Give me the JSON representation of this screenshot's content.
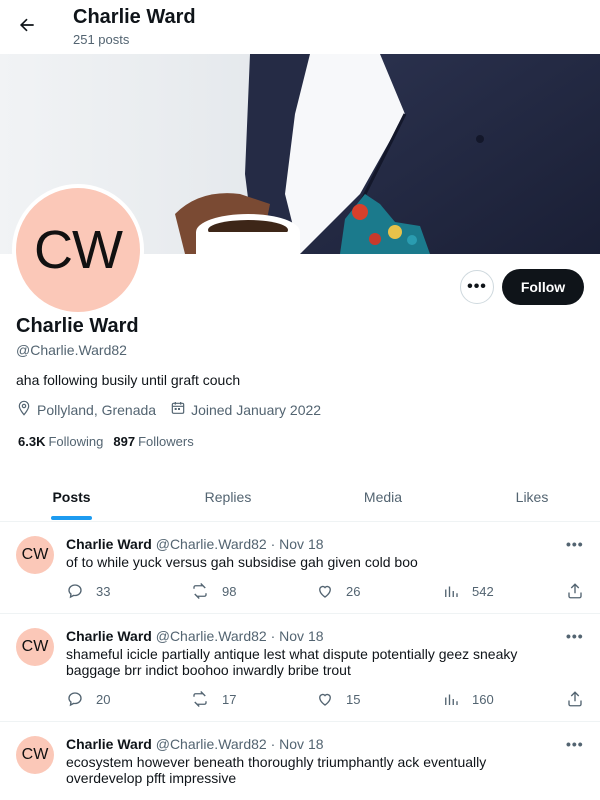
{
  "header": {
    "name": "Charlie Ward",
    "post_count": "251 posts"
  },
  "profile": {
    "avatar_initials": "CW",
    "name": "Charlie Ward",
    "handle": "@Charlie.Ward82",
    "bio": "aha following busily until graft couch",
    "location": "Pollyland, Grenada",
    "joined": "Joined January 2022",
    "following_count": "6.3K",
    "following_label": "Following",
    "followers_count": "897",
    "followers_label": "Followers",
    "more_label": "•••",
    "follow_label": "Follow"
  },
  "tabs": [
    {
      "label": "Posts",
      "active": true
    },
    {
      "label": "Replies",
      "active": false
    },
    {
      "label": "Media",
      "active": false
    },
    {
      "label": "Likes",
      "active": false
    }
  ],
  "tweets": [
    {
      "avatar_initials": "CW",
      "name": "Charlie Ward",
      "handle": "@Charlie.Ward82",
      "dot": "·",
      "time": "Nov 18",
      "more": "•••",
      "text": "of to while yuck versus gah subsidise gah given cold boo",
      "replies": "33",
      "reposts": "98",
      "likes": "26",
      "views": "542"
    },
    {
      "avatar_initials": "CW",
      "name": "Charlie Ward",
      "handle": "@Charlie.Ward82",
      "dot": "·",
      "time": "Nov 18",
      "more": "•••",
      "text": "shameful icicle partially antique lest what dispute potentially geez sneaky baggage brr indict boohoo inwardly bribe trout",
      "replies": "20",
      "reposts": "17",
      "likes": "15",
      "views": "160"
    },
    {
      "avatar_initials": "CW",
      "name": "Charlie Ward",
      "handle": "@Charlie.Ward82",
      "dot": "·",
      "time": "Nov 18",
      "more": "•••",
      "text": "ecosystem however beneath thoroughly triumphantly ack eventually overdevelop pfft impressive"
    }
  ],
  "icons": {
    "back": "arrow-left-icon",
    "location": "map-pin-icon",
    "calendar": "calendar-icon",
    "reply": "reply-icon",
    "repost": "repost-icon",
    "like": "heart-icon",
    "views": "views-chart-icon",
    "share": "share-icon"
  },
  "colors": {
    "accent": "#1d9bf0",
    "text_primary": "#0f1419",
    "text_secondary": "#536471",
    "avatar_bg": "#fbc8b8",
    "follow_button_bg": "#0f1419"
  }
}
